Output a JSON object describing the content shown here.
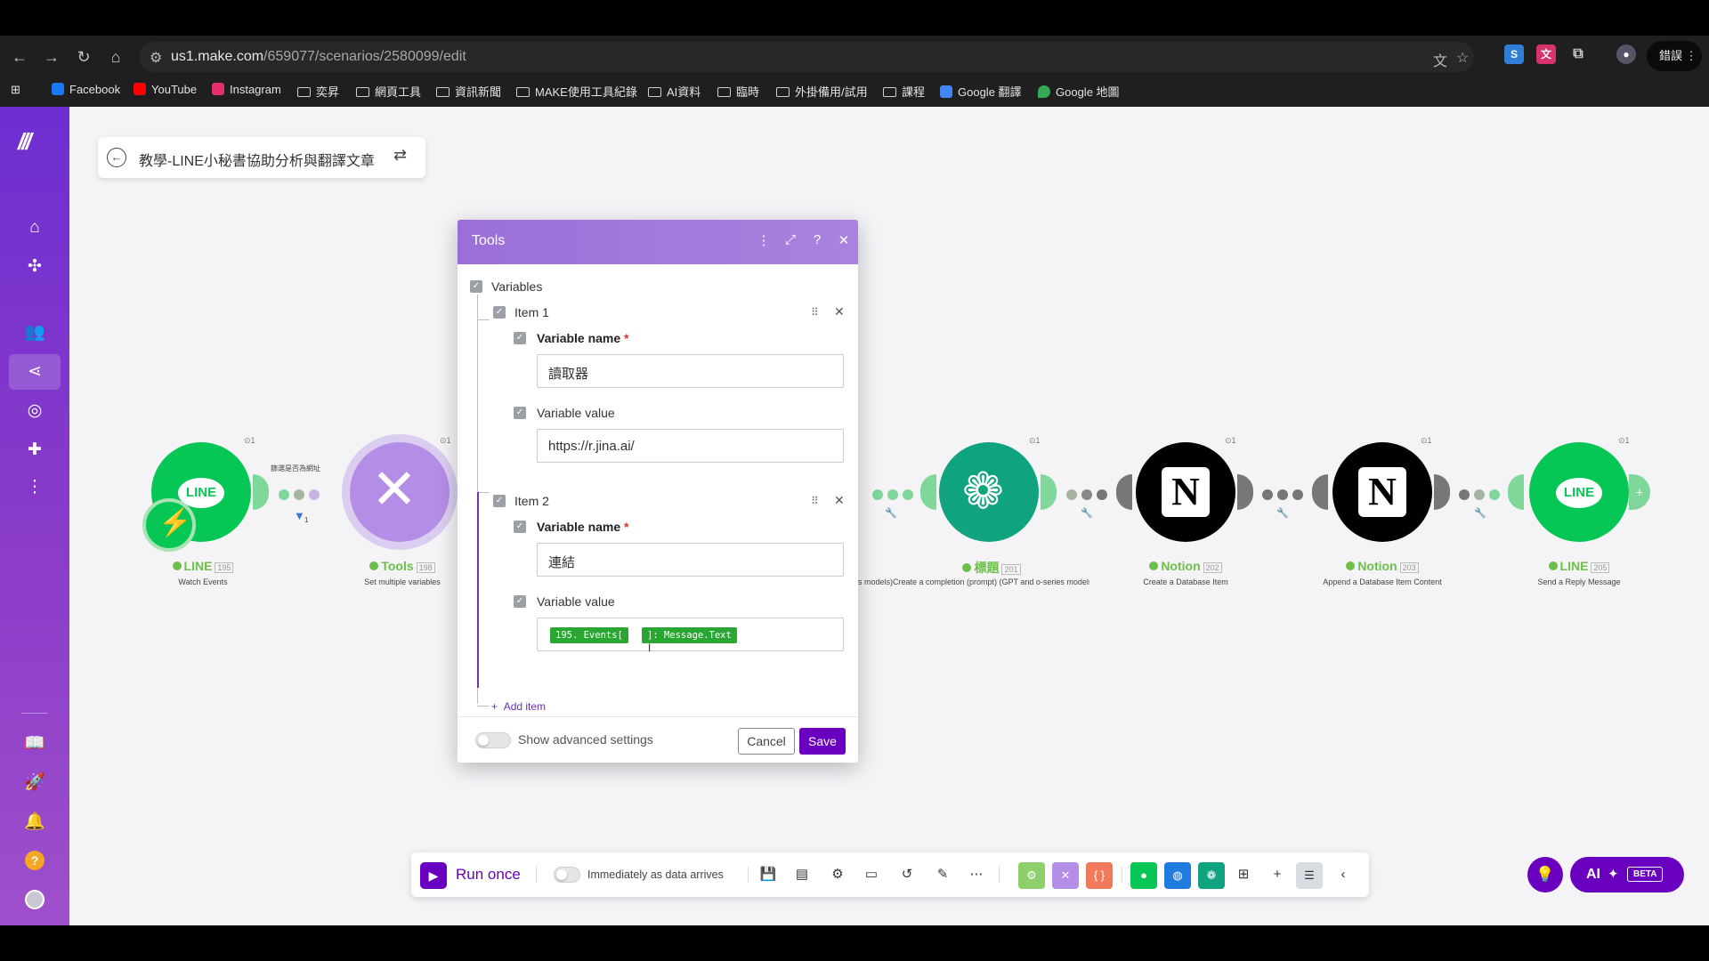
{
  "browser": {
    "url_host": "us1.make.com",
    "url_path": "/659077/scenarios/2580099/edit",
    "profile_label": "錯誤",
    "bookmarks": [
      {
        "label": "Facebook",
        "icon": "facebook-icon",
        "color": "#1877f2"
      },
      {
        "label": "YouTube",
        "icon": "youtube-icon",
        "color": "#ff0000"
      },
      {
        "label": "Instagram",
        "icon": "instagram-icon",
        "color": "#e1306c"
      },
      {
        "label": "奕昇",
        "icon": "folder-icon"
      },
      {
        "label": "網頁工具",
        "icon": "folder-icon"
      },
      {
        "label": "資訊新聞",
        "icon": "folder-icon"
      },
      {
        "label": "MAKE使用工具紀錄",
        "icon": "folder-icon"
      },
      {
        "label": "AI資料",
        "icon": "folder-icon"
      },
      {
        "label": "臨時",
        "icon": "folder-icon"
      },
      {
        "label": "外掛備用/試用",
        "icon": "folder-icon"
      },
      {
        "label": "課程",
        "icon": "folder-icon"
      },
      {
        "label": "Google 翻譯",
        "icon": "google-translate-icon",
        "color": "#4285f4"
      },
      {
        "label": "Google 地圖",
        "icon": "google-maps-icon",
        "color": "#34a853"
      }
    ]
  },
  "scenario": {
    "title": "教學-LINE小秘書協助分析與翻譯文章"
  },
  "flow": {
    "filter_label": "篩選是否為網址",
    "filter_count": "1",
    "nodes": [
      {
        "name": "LINE",
        "id": "195",
        "sub": "Watch Events",
        "ops": "1",
        "color": "#06c755"
      },
      {
        "name": "Tools",
        "id": "198",
        "sub": "Set multiple variables",
        "ops": "1",
        "color": "#b48ee6"
      },
      {
        "name": "標題",
        "id": "201",
        "sub": "Create a completion (prompt) (GPT and o-series models)",
        "sub_visible": "s models)Create a completion (prompt) (GPT and o-series models)",
        "ops": "1",
        "color": "#10a37f"
      },
      {
        "name": "Notion",
        "id": "202",
        "sub": "Create a Database Item",
        "ops": "1",
        "color": "#000000"
      },
      {
        "name": "Notion",
        "id": "203",
        "sub": "Append a Database Item Content",
        "ops": "1",
        "color": "#000000"
      },
      {
        "name": "LINE",
        "id": "205",
        "sub": "Send a Reply Message",
        "ops": "1",
        "color": "#06c755"
      }
    ]
  },
  "dialog": {
    "title": "Tools",
    "section_label": "Variables",
    "items": [
      {
        "label": "Item 1",
        "name_label": "Variable name",
        "name_value": "讀取器",
        "value_label": "Variable value",
        "value_text": "https://r.jina.ai/"
      },
      {
        "label": "Item 2",
        "name_label": "Variable name",
        "name_value": "連結",
        "value_label": "Variable value",
        "value_pills": [
          "195. Events[",
          "]: Message.Text"
        ]
      }
    ],
    "add_item_label": "Add item",
    "advanced_label": "Show advanced settings",
    "cancel_label": "Cancel",
    "save_label": "Save"
  },
  "toolbar": {
    "run_once_label": "Run once",
    "immediately_label": "Immediately as data arrives",
    "ai_label": "AI",
    "beta_label": "BETA"
  },
  "colors": {
    "brand_purple": "#6a00bf",
    "line_green": "#06c755",
    "pill_green": "#2aa732"
  }
}
